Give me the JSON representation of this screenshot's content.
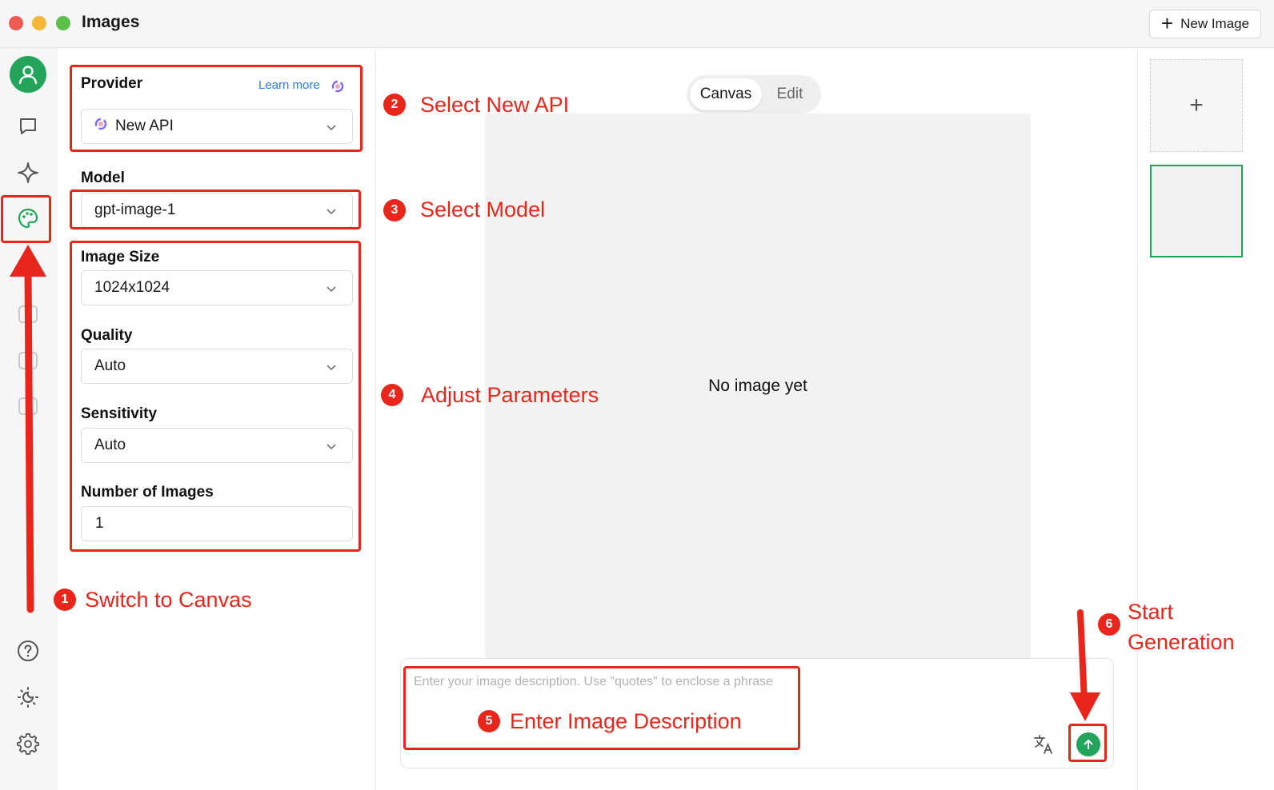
{
  "window": {
    "title": "Images",
    "new_image_label": "New Image"
  },
  "sidebar": {
    "items": [
      {
        "name": "avatar"
      },
      {
        "name": "chat-icon"
      },
      {
        "name": "sparkle-icon"
      },
      {
        "name": "palette-icon",
        "active": true
      },
      {
        "name": "help-icon"
      },
      {
        "name": "theme-icon"
      },
      {
        "name": "settings-icon"
      }
    ]
  },
  "params": {
    "provider_label": "Provider",
    "learn_more": "Learn more",
    "provider_value": "New API",
    "model_label": "Model",
    "model_value": "gpt-image-1",
    "size_label": "Image Size",
    "size_value": "1024x1024",
    "quality_label": "Quality",
    "quality_value": "Auto",
    "sensitivity_label": "Sensitivity",
    "sensitivity_value": "Auto",
    "count_label": "Number of Images",
    "count_value": "1"
  },
  "canvas": {
    "tabs": [
      "Canvas",
      "Edit"
    ],
    "active_tab": "Canvas",
    "empty_text": "No image yet",
    "prompt_placeholder": "Enter your image description. Use \"quotes\" to enclose a phrase"
  },
  "annotations": {
    "steps": [
      {
        "number": "1",
        "label": "Switch to Canvas"
      },
      {
        "number": "2",
        "label": "Select New API"
      },
      {
        "number": "3",
        "label": "Select Model"
      },
      {
        "number": "4",
        "label": "Adjust Parameters"
      },
      {
        "number": "5",
        "label": "Enter Image Description"
      },
      {
        "number": "6",
        "label_line1": "Start",
        "label_line2": "Generation"
      }
    ]
  },
  "colors": {
    "accent": "#22a55a",
    "annotation": "#e8261c",
    "link": "#2f7de1"
  }
}
